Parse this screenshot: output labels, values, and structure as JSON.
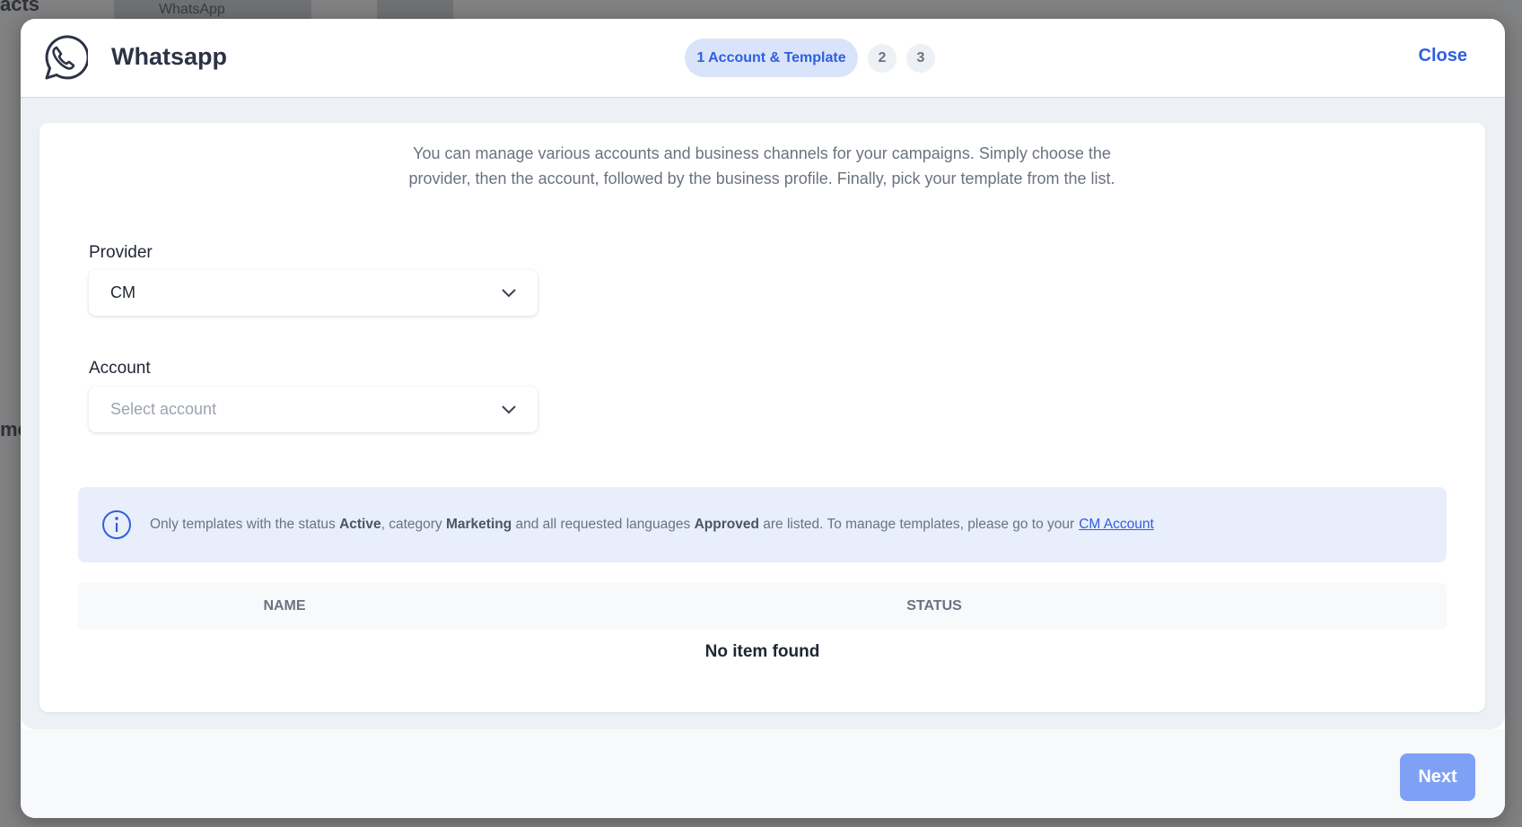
{
  "background": {
    "node_label": "WhatsApp",
    "left_text_top": "acts",
    "left_text_mid": "mc"
  },
  "header": {
    "title": "Whatsapp",
    "icon": "whatsapp-icon",
    "steps": [
      {
        "label": "1 Account & Template",
        "active": true
      },
      {
        "label": "2"
      },
      {
        "label": "3"
      }
    ],
    "close_label": "Close"
  },
  "main": {
    "description": "You can manage various accounts and business channels for your campaigns. Simply choose the provider, then the account, followed by the business profile. Finally, pick your template from the list.",
    "provider": {
      "label": "Provider",
      "value": "CM"
    },
    "account": {
      "label": "Account",
      "placeholder": "Select account"
    },
    "info": {
      "icon": "info-icon",
      "t1": "Only templates with the status ",
      "b1": "Active",
      "t2": ", category ",
      "b2": "Marketing",
      "t3": " and all requested languages ",
      "b3": "Approved",
      "t4": " are listed. To manage templates, please go to your",
      "link": "CM Account"
    },
    "table": {
      "columns": [
        "NAME",
        "STATUS"
      ],
      "empty": "No item found"
    }
  },
  "footer": {
    "next_label": "Next"
  },
  "colors": {
    "accent": "#2f5fe0",
    "next_button": "#7fa1f5",
    "info_bg": "#e8eefb"
  }
}
